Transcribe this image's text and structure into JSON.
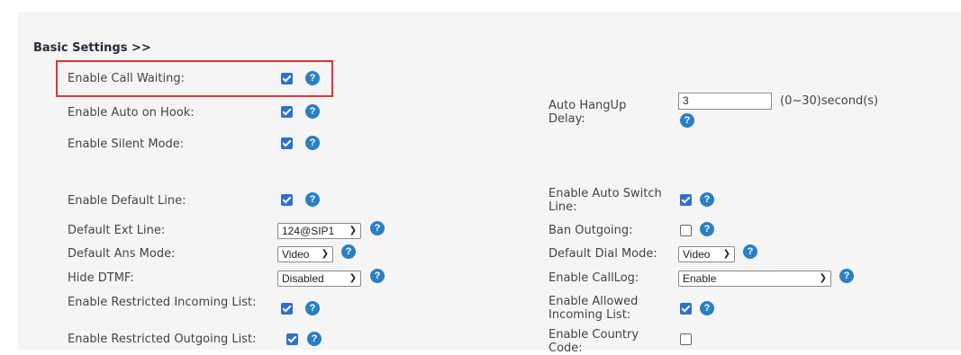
{
  "section": {
    "title": "Basic Settings >>"
  },
  "help_glyph": "?",
  "colors": {
    "checkbox_checked": "#2f6fce",
    "help_icon": "#2a7fc4",
    "highlight_border": "#e53232"
  },
  "left": {
    "call_waiting": {
      "label": "Enable Call Waiting:",
      "checked": true
    },
    "auto_on_hook": {
      "label": "Enable Auto on Hook:",
      "checked": true
    },
    "silent_mode": {
      "label": "Enable Silent Mode:",
      "checked": true
    },
    "default_line": {
      "label": "Enable Default Line:",
      "checked": true
    },
    "default_ext_line": {
      "label": "Default Ext Line:",
      "value": "124@SIP1"
    },
    "default_ans_mode": {
      "label": "Default Ans Mode:",
      "value": "Video"
    },
    "hide_dtmf": {
      "label": "Hide DTMF:",
      "value": "Disabled"
    },
    "restricted_incoming": {
      "label": "Enable Restricted Incoming List:",
      "checked": true
    },
    "restricted_outgoing": {
      "label": "Enable Restricted Outgoing List:",
      "checked": true
    }
  },
  "right": {
    "auto_hangup_delay": {
      "label": "Auto HangUp Delay:",
      "value": "3",
      "unit": "(0~30)second(s)"
    },
    "auto_switch_line": {
      "label": "Enable Auto Switch Line:",
      "checked": true
    },
    "ban_outgoing": {
      "label": "Ban Outgoing:",
      "checked": false
    },
    "default_dial_mode": {
      "label": "Default Dial Mode:",
      "value": "Video"
    },
    "call_log": {
      "label": "Enable CallLog:",
      "value": "Enable"
    },
    "allowed_incoming": {
      "label": "Enable Allowed Incoming List:",
      "checked": true
    },
    "country_code": {
      "label": "Enable Country Code:",
      "checked": false
    }
  }
}
